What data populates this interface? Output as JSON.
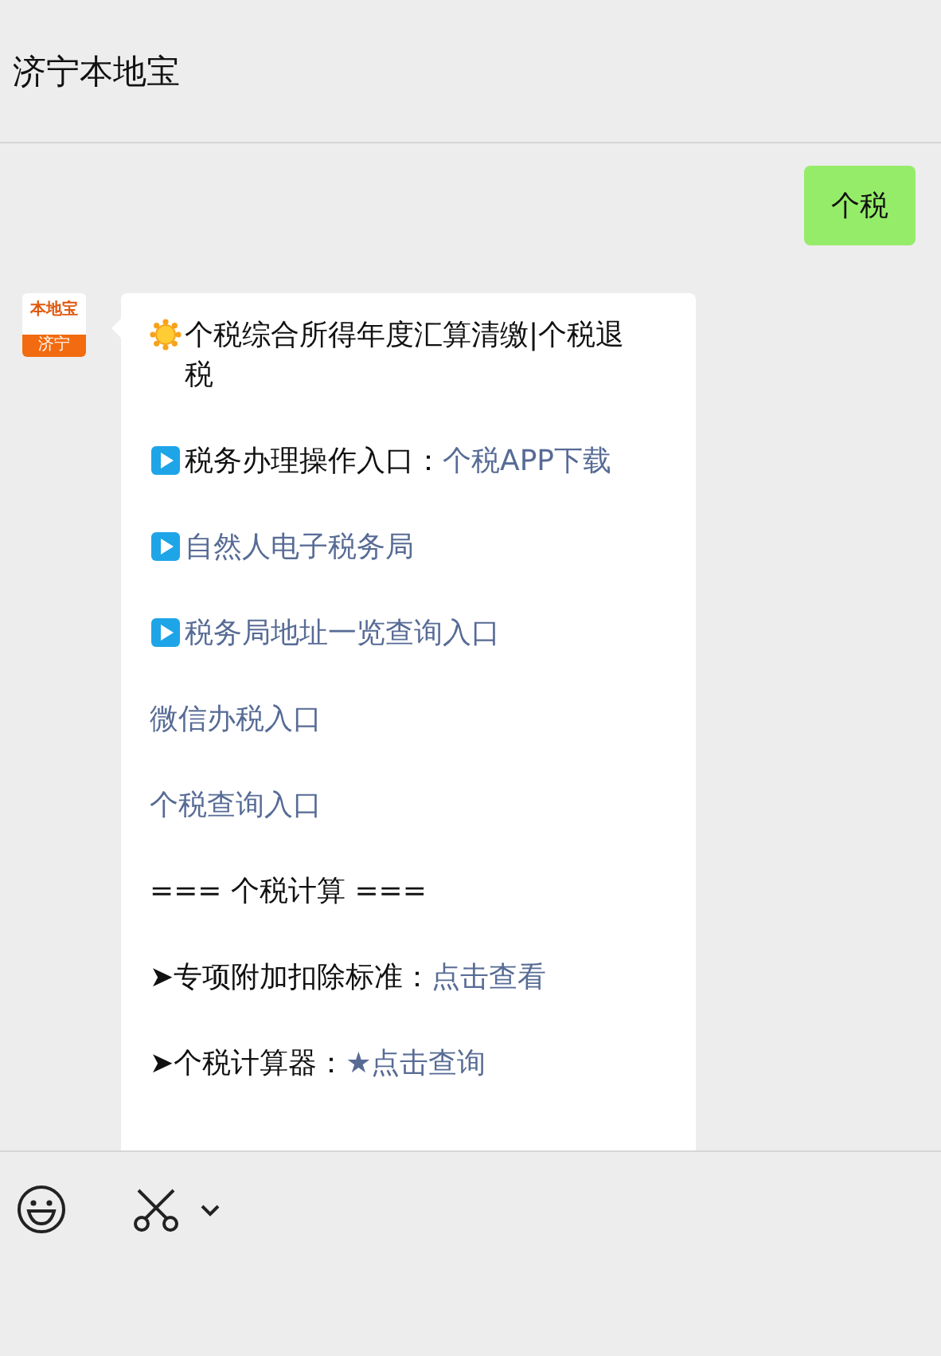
{
  "header": {
    "title": "济宁本地宝"
  },
  "messages": [
    {
      "kind": "sent",
      "text": "个税"
    },
    {
      "kind": "received",
      "avatar": {
        "brand": "本地宝",
        "city": "济宁"
      },
      "lines": [
        {
          "kind": "sun",
          "text": "个税综合所得年度汇算清缴|个税退税"
        },
        {
          "kind": "play",
          "text": "税务办理操作入口：",
          "link": "个税APP下载"
        },
        {
          "kind": "play",
          "link": "自然人电子税务局"
        },
        {
          "kind": "play",
          "link": "税务局地址一览查询入口"
        },
        {
          "kind": "plain",
          "link": "微信办税入口"
        },
        {
          "kind": "plain",
          "link": "个税查询入口"
        },
        {
          "kind": "plain",
          "text": "=== 个税计算 ==="
        },
        {
          "kind": "plain",
          "text": "➤专项附加扣除标准：",
          "link": "点击查看"
        },
        {
          "kind": "plain",
          "text": "➤个税计算器：",
          "link": "★点击查询"
        }
      ]
    }
  ]
}
